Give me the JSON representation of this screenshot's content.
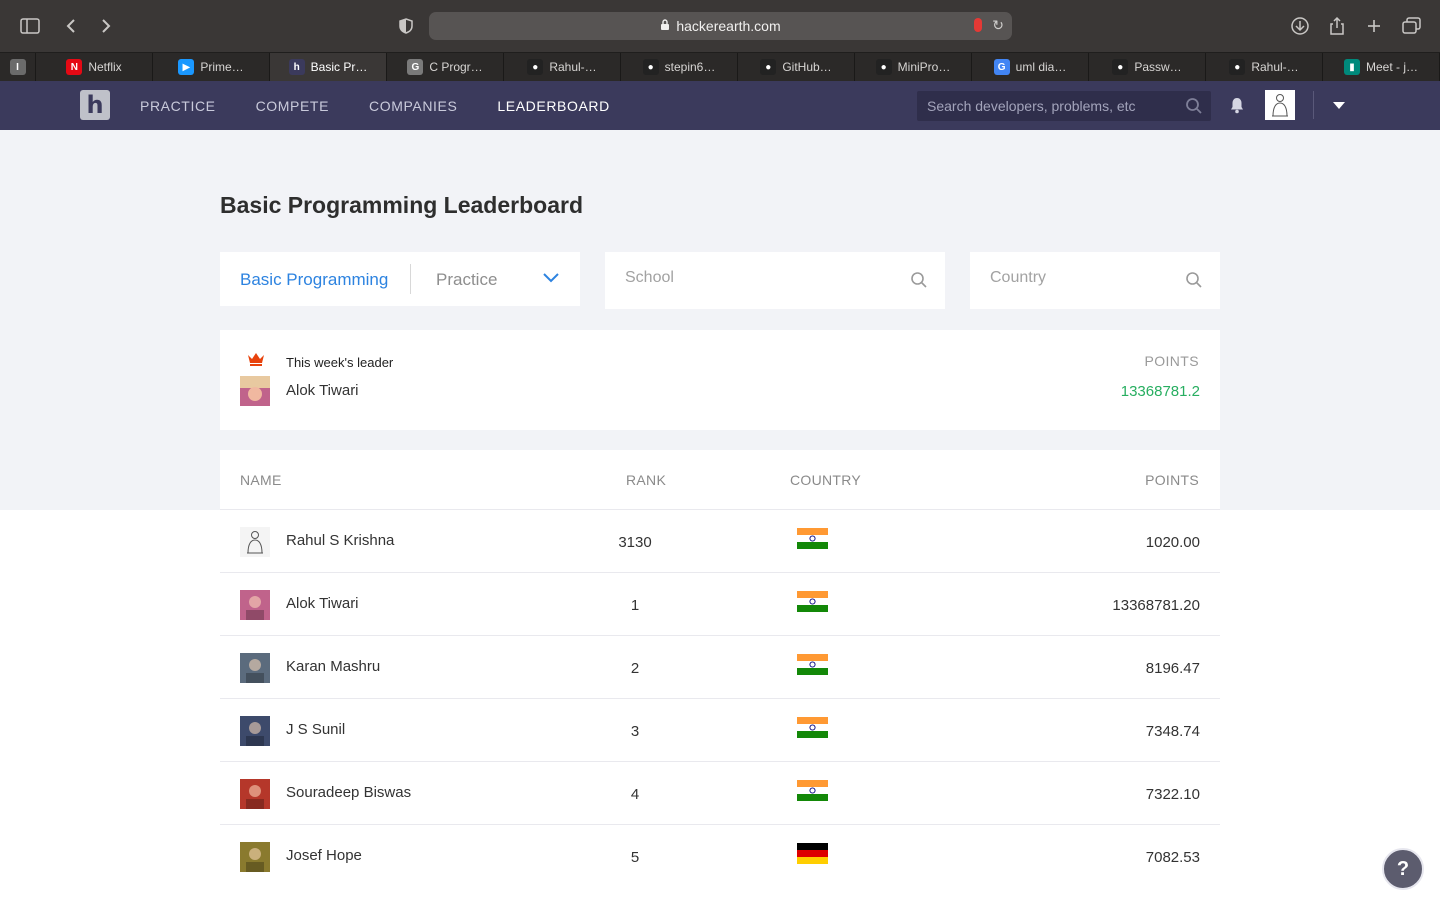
{
  "browser": {
    "url": "hackerearth.com",
    "tabs": [
      {
        "label": "",
        "icon_letter": "I",
        "icon_color": "#6b6b6b"
      },
      {
        "label": "Netflix",
        "icon_letter": "N",
        "icon_color": "#e50914"
      },
      {
        "label": "Prime…",
        "icon_letter": "▶",
        "icon_color": "#1a98ff"
      },
      {
        "label": "Basic Pr…",
        "icon_letter": "h",
        "icon_color": "#3b3a5c"
      },
      {
        "label": "C Progr…",
        "icon_letter": "G",
        "icon_color": "#7a7a7a"
      },
      {
        "label": "Rahul-…",
        "icon_letter": "●",
        "icon_color": "#222222"
      },
      {
        "label": "stepin6…",
        "icon_letter": "●",
        "icon_color": "#222222"
      },
      {
        "label": "GitHub…",
        "icon_letter": "●",
        "icon_color": "#222222"
      },
      {
        "label": "MiniPro…",
        "icon_letter": "●",
        "icon_color": "#222222"
      },
      {
        "label": "uml dia…",
        "icon_letter": "G",
        "icon_color": "#4285f4"
      },
      {
        "label": "Passw…",
        "icon_letter": "●",
        "icon_color": "#222222"
      },
      {
        "label": "Rahul-…",
        "icon_letter": "●",
        "icon_color": "#222222"
      },
      {
        "label": "Meet - j…",
        "icon_letter": "▮",
        "icon_color": "#00897b"
      }
    ]
  },
  "header": {
    "logo_letter": "h",
    "nav": [
      "PRACTICE",
      "COMPETE",
      "COMPANIES",
      "LEADERBOARD"
    ],
    "active_nav": "LEADERBOARD",
    "search_placeholder": "Search developers, problems, etc"
  },
  "page": {
    "title": "Basic Programming Leaderboard",
    "filter_track": "Basic Programming",
    "filter_mode": "Practice",
    "school_placeholder": "School",
    "country_placeholder": "Country"
  },
  "leader": {
    "label": "This week's leader",
    "name": "Alok Tiwari",
    "points_label": "POINTS",
    "points": "13368781.2"
  },
  "table": {
    "headers": {
      "name": "NAME",
      "rank": "RANK",
      "country": "COUNTRY",
      "points": "POINTS"
    },
    "rows": [
      {
        "name": "Rahul S Krishna",
        "rank": "3130",
        "country": "india",
        "points": "1020.00",
        "avatar_color": "#f4f4f4"
      },
      {
        "name": "Alok Tiwari",
        "rank": "1",
        "country": "india",
        "points": "13368781.20",
        "avatar_color": "#c0638b"
      },
      {
        "name": "Karan Mashru",
        "rank": "2",
        "country": "india",
        "points": "8196.47",
        "avatar_color": "#5b6b7d"
      },
      {
        "name": "J S Sunil",
        "rank": "3",
        "country": "india",
        "points": "7348.74",
        "avatar_color": "#3d4a6b"
      },
      {
        "name": "Souradeep Biswas",
        "rank": "4",
        "country": "india",
        "points": "7322.10",
        "avatar_color": "#b5372a"
      },
      {
        "name": "Josef Hope",
        "rank": "5",
        "country": "germany",
        "points": "7082.53",
        "avatar_color": "#8a7a2e"
      }
    ]
  },
  "help_label": "?"
}
